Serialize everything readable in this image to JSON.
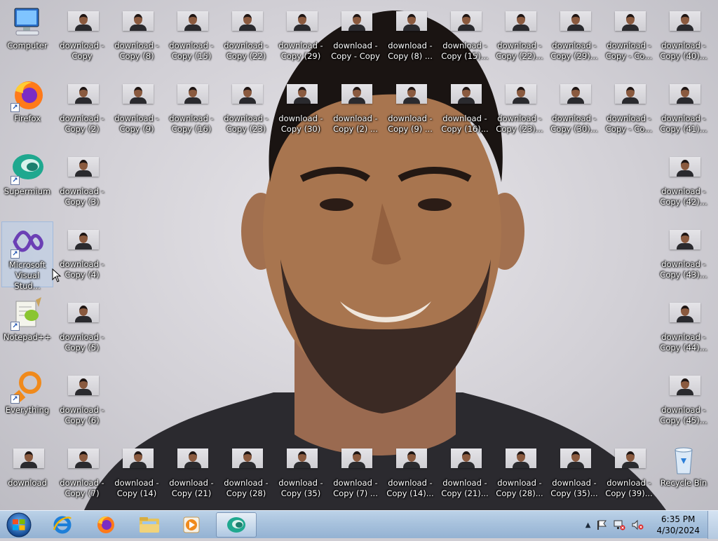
{
  "desktop": {
    "system_icons": [
      {
        "label": "Computer",
        "icon": "computer-icon"
      },
      {
        "label": "Firefox",
        "icon": "firefox-icon"
      },
      {
        "label": "Supermium",
        "icon": "supermium-icon"
      },
      {
        "label": "Microsoft\nVisual Stud...",
        "icon": "visual-studio-icon"
      },
      {
        "label": "Notepad++",
        "icon": "notepad-plus-plus-icon"
      },
      {
        "label": "Everything",
        "icon": "everything-icon"
      },
      {
        "label": "download",
        "icon": "image-file-icon"
      }
    ],
    "files": [
      "download -\nCopy",
      "download -\nCopy (8)",
      "download -\nCopy (15)",
      "download -\nCopy (22)",
      "download -\nCopy (29)",
      "download -\nCopy - Copy",
      "download -\nCopy (8) ...",
      "download -\nCopy (15)...",
      "download -\nCopy (22)...",
      "download -\nCopy (29)...",
      "download -\nCopy - Co...",
      "download -\nCopy (40)...",
      "download -\nCopy (2)",
      "download -\nCopy (9)",
      "download -\nCopy (16)",
      "download -\nCopy (23)",
      "download -\nCopy (30)",
      "download -\nCopy (2) ...",
      "download -\nCopy (9) ...",
      "download -\nCopy (16)...",
      "download -\nCopy (23)...",
      "download -\nCopy (30)...",
      "download -\nCopy - Co...",
      "download -\nCopy (41)...",
      "download -\nCopy (3)",
      "download -\nCopy (42)...",
      "download -\nCopy (4)",
      "download -\nCopy (43)...",
      "download -\nCopy (5)",
      "download -\nCopy (44)...",
      "download -\nCopy (6)",
      "download -\nCopy (45)...",
      "download -\nCopy (7)",
      "download -\nCopy (14)",
      "download -\nCopy (21)",
      "download -\nCopy (28)",
      "download -\nCopy (35)",
      "download -\nCopy (7) ...",
      "download -\nCopy (14)...",
      "download -\nCopy (21)...",
      "download -\nCopy (28)...",
      "download -\nCopy (35)...",
      "download -\nCopy (39)..."
    ],
    "recycle_bin": {
      "label": "Recycle Bin",
      "icon": "recycle-bin-icon"
    }
  },
  "taskbar": {
    "start": {
      "icon": "windows-start-icon"
    },
    "pinned": [
      {
        "icon": "internet-explorer-icon"
      },
      {
        "icon": "firefox-icon"
      },
      {
        "icon": "file-explorer-icon"
      },
      {
        "icon": "media-player-icon"
      },
      {
        "icon": "supermium-icon",
        "active": true
      }
    ],
    "tray": {
      "icons": [
        "show-hidden-icons-chevron",
        "action-center-flag-icon",
        "network-icon",
        "volume-muted-icon"
      ],
      "time": "6:35 PM",
      "date": "4/30/2024"
    }
  }
}
